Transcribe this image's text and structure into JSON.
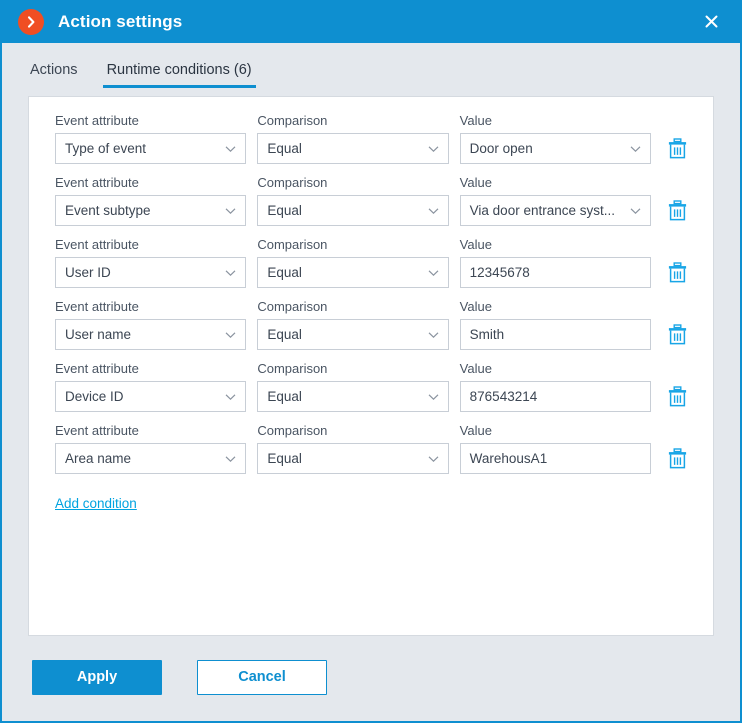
{
  "window": {
    "title": "Action settings",
    "app_icon": "chevron-right-circle-icon",
    "close_icon": "close-icon",
    "accent_color": "#0e8fd0",
    "app_icon_color": "#f04e23",
    "link_color": "#00a3e0",
    "background_color": "#e4e8ed"
  },
  "tabs": [
    {
      "label": "Actions",
      "active": false
    },
    {
      "label": "Runtime conditions (6)",
      "active": true
    }
  ],
  "form": {
    "labels": {
      "attribute": "Event attribute",
      "comparison": "Comparison",
      "value": "Value"
    },
    "delete_icon": "trash-icon",
    "conditions": [
      {
        "attribute": "Type of event",
        "comparison": "Equal",
        "value": "Door open",
        "value_type": "select"
      },
      {
        "attribute": "Event subtype",
        "comparison": "Equal",
        "value": "Via door entrance syst...",
        "value_type": "select"
      },
      {
        "attribute": "User ID",
        "comparison": "Equal",
        "value": "12345678",
        "value_type": "text"
      },
      {
        "attribute": "User name",
        "comparison": "Equal",
        "value": "Smith",
        "value_type": "text"
      },
      {
        "attribute": "Device ID",
        "comparison": "Equal",
        "value": "876543214",
        "value_type": "text"
      },
      {
        "attribute": "Area name",
        "comparison": "Equal",
        "value": "WarehousA1",
        "value_type": "text"
      }
    ],
    "add_condition_label": "Add condition"
  },
  "footer": {
    "apply_label": "Apply",
    "cancel_label": "Cancel"
  }
}
